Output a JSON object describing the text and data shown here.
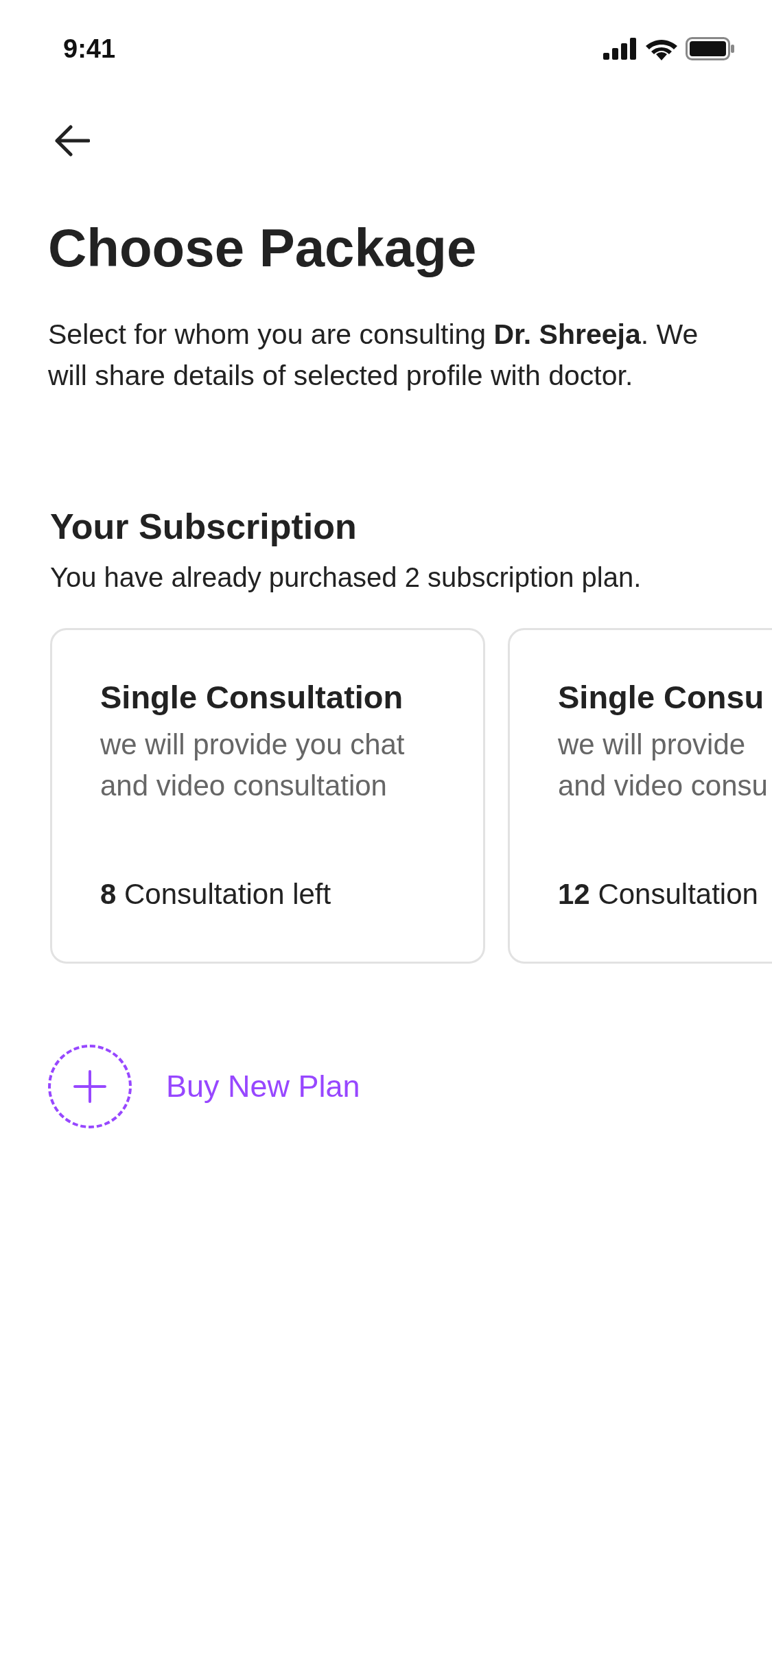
{
  "status_bar": {
    "time": "9:41"
  },
  "title": "Choose Package",
  "description": "Select for whom you are consulting **Dr. Shreeja**. We will share details of selected profile with doctor.",
  "subscription": {
    "heading": "Your Subscription",
    "subtext": "You have already purchased 2 subscription plan.",
    "plans": [
      {
        "name": "Single Consultation",
        "description_lines": [
          "we will provide you chat",
          "and video consultation"
        ],
        "remaining": "**8** Consultation left"
      },
      {
        "name": "Single Consu",
        "description_lines": [
          "we will provide",
          "and video consu"
        ],
        "remaining": "**12** Consultation"
      }
    ]
  },
  "buy_button": {
    "label": "Buy New Plan"
  }
}
